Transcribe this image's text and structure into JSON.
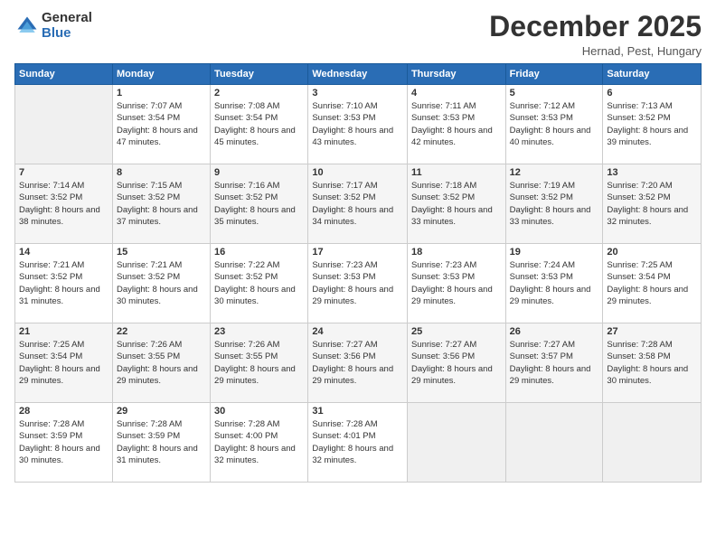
{
  "logo": {
    "general": "General",
    "blue": "Blue"
  },
  "title": "December 2025",
  "location": "Hernad, Pest, Hungary",
  "days_header": [
    "Sunday",
    "Monday",
    "Tuesday",
    "Wednesday",
    "Thursday",
    "Friday",
    "Saturday"
  ],
  "weeks": [
    [
      {
        "day": "",
        "sunrise": "",
        "sunset": "",
        "daylight": ""
      },
      {
        "day": "1",
        "sunrise": "Sunrise: 7:07 AM",
        "sunset": "Sunset: 3:54 PM",
        "daylight": "Daylight: 8 hours and 47 minutes."
      },
      {
        "day": "2",
        "sunrise": "Sunrise: 7:08 AM",
        "sunset": "Sunset: 3:54 PM",
        "daylight": "Daylight: 8 hours and 45 minutes."
      },
      {
        "day": "3",
        "sunrise": "Sunrise: 7:10 AM",
        "sunset": "Sunset: 3:53 PM",
        "daylight": "Daylight: 8 hours and 43 minutes."
      },
      {
        "day": "4",
        "sunrise": "Sunrise: 7:11 AM",
        "sunset": "Sunset: 3:53 PM",
        "daylight": "Daylight: 8 hours and 42 minutes."
      },
      {
        "day": "5",
        "sunrise": "Sunrise: 7:12 AM",
        "sunset": "Sunset: 3:53 PM",
        "daylight": "Daylight: 8 hours and 40 minutes."
      },
      {
        "day": "6",
        "sunrise": "Sunrise: 7:13 AM",
        "sunset": "Sunset: 3:52 PM",
        "daylight": "Daylight: 8 hours and 39 minutes."
      }
    ],
    [
      {
        "day": "7",
        "sunrise": "Sunrise: 7:14 AM",
        "sunset": "Sunset: 3:52 PM",
        "daylight": "Daylight: 8 hours and 38 minutes."
      },
      {
        "day": "8",
        "sunrise": "Sunrise: 7:15 AM",
        "sunset": "Sunset: 3:52 PM",
        "daylight": "Daylight: 8 hours and 37 minutes."
      },
      {
        "day": "9",
        "sunrise": "Sunrise: 7:16 AM",
        "sunset": "Sunset: 3:52 PM",
        "daylight": "Daylight: 8 hours and 35 minutes."
      },
      {
        "day": "10",
        "sunrise": "Sunrise: 7:17 AM",
        "sunset": "Sunset: 3:52 PM",
        "daylight": "Daylight: 8 hours and 34 minutes."
      },
      {
        "day": "11",
        "sunrise": "Sunrise: 7:18 AM",
        "sunset": "Sunset: 3:52 PM",
        "daylight": "Daylight: 8 hours and 33 minutes."
      },
      {
        "day": "12",
        "sunrise": "Sunrise: 7:19 AM",
        "sunset": "Sunset: 3:52 PM",
        "daylight": "Daylight: 8 hours and 33 minutes."
      },
      {
        "day": "13",
        "sunrise": "Sunrise: 7:20 AM",
        "sunset": "Sunset: 3:52 PM",
        "daylight": "Daylight: 8 hours and 32 minutes."
      }
    ],
    [
      {
        "day": "14",
        "sunrise": "Sunrise: 7:21 AM",
        "sunset": "Sunset: 3:52 PM",
        "daylight": "Daylight: 8 hours and 31 minutes."
      },
      {
        "day": "15",
        "sunrise": "Sunrise: 7:21 AM",
        "sunset": "Sunset: 3:52 PM",
        "daylight": "Daylight: 8 hours and 30 minutes."
      },
      {
        "day": "16",
        "sunrise": "Sunrise: 7:22 AM",
        "sunset": "Sunset: 3:52 PM",
        "daylight": "Daylight: 8 hours and 30 minutes."
      },
      {
        "day": "17",
        "sunrise": "Sunrise: 7:23 AM",
        "sunset": "Sunset: 3:53 PM",
        "daylight": "Daylight: 8 hours and 29 minutes."
      },
      {
        "day": "18",
        "sunrise": "Sunrise: 7:23 AM",
        "sunset": "Sunset: 3:53 PM",
        "daylight": "Daylight: 8 hours and 29 minutes."
      },
      {
        "day": "19",
        "sunrise": "Sunrise: 7:24 AM",
        "sunset": "Sunset: 3:53 PM",
        "daylight": "Daylight: 8 hours and 29 minutes."
      },
      {
        "day": "20",
        "sunrise": "Sunrise: 7:25 AM",
        "sunset": "Sunset: 3:54 PM",
        "daylight": "Daylight: 8 hours and 29 minutes."
      }
    ],
    [
      {
        "day": "21",
        "sunrise": "Sunrise: 7:25 AM",
        "sunset": "Sunset: 3:54 PM",
        "daylight": "Daylight: 8 hours and 29 minutes."
      },
      {
        "day": "22",
        "sunrise": "Sunrise: 7:26 AM",
        "sunset": "Sunset: 3:55 PM",
        "daylight": "Daylight: 8 hours and 29 minutes."
      },
      {
        "day": "23",
        "sunrise": "Sunrise: 7:26 AM",
        "sunset": "Sunset: 3:55 PM",
        "daylight": "Daylight: 8 hours and 29 minutes."
      },
      {
        "day": "24",
        "sunrise": "Sunrise: 7:27 AM",
        "sunset": "Sunset: 3:56 PM",
        "daylight": "Daylight: 8 hours and 29 minutes."
      },
      {
        "day": "25",
        "sunrise": "Sunrise: 7:27 AM",
        "sunset": "Sunset: 3:56 PM",
        "daylight": "Daylight: 8 hours and 29 minutes."
      },
      {
        "day": "26",
        "sunrise": "Sunrise: 7:27 AM",
        "sunset": "Sunset: 3:57 PM",
        "daylight": "Daylight: 8 hours and 29 minutes."
      },
      {
        "day": "27",
        "sunrise": "Sunrise: 7:28 AM",
        "sunset": "Sunset: 3:58 PM",
        "daylight": "Daylight: 8 hours and 30 minutes."
      }
    ],
    [
      {
        "day": "28",
        "sunrise": "Sunrise: 7:28 AM",
        "sunset": "Sunset: 3:59 PM",
        "daylight": "Daylight: 8 hours and 30 minutes."
      },
      {
        "day": "29",
        "sunrise": "Sunrise: 7:28 AM",
        "sunset": "Sunset: 3:59 PM",
        "daylight": "Daylight: 8 hours and 31 minutes."
      },
      {
        "day": "30",
        "sunrise": "Sunrise: 7:28 AM",
        "sunset": "Sunset: 4:00 PM",
        "daylight": "Daylight: 8 hours and 32 minutes."
      },
      {
        "day": "31",
        "sunrise": "Sunrise: 7:28 AM",
        "sunset": "Sunset: 4:01 PM",
        "daylight": "Daylight: 8 hours and 32 minutes."
      },
      {
        "day": "",
        "sunrise": "",
        "sunset": "",
        "daylight": ""
      },
      {
        "day": "",
        "sunrise": "",
        "sunset": "",
        "daylight": ""
      },
      {
        "day": "",
        "sunrise": "",
        "sunset": "",
        "daylight": ""
      }
    ]
  ]
}
